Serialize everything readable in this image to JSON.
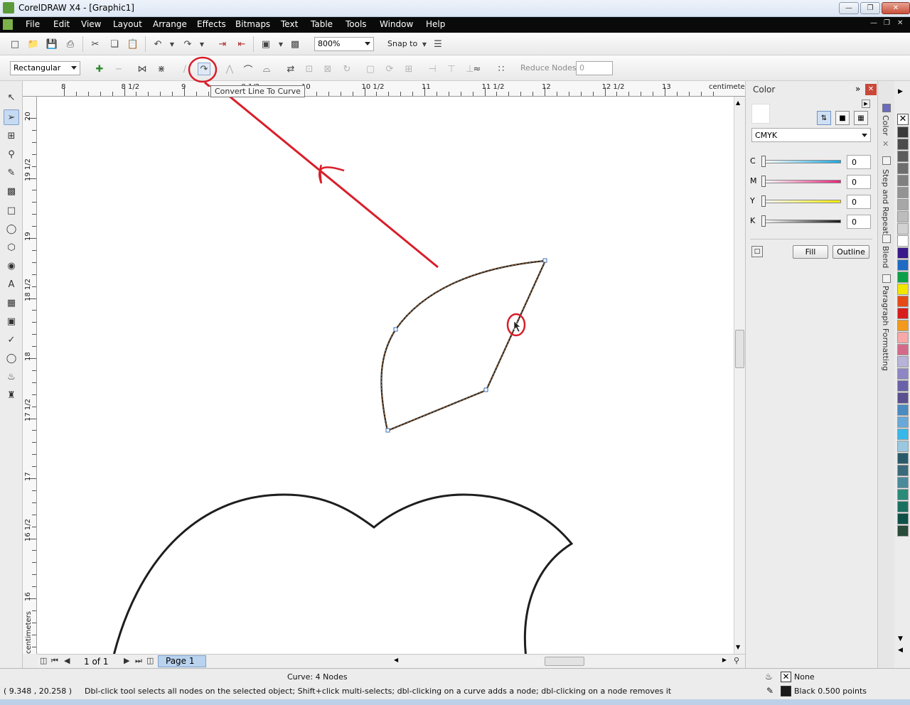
{
  "window": {
    "title": "CorelDRAW X4 - [Graphic1]"
  },
  "menu": [
    "File",
    "Edit",
    "View",
    "Layout",
    "Arrange",
    "Effects",
    "Bitmaps",
    "Text",
    "Table",
    "Tools",
    "Window",
    "Help"
  ],
  "toolbar": {
    "zoom": "800%",
    "snap_label": "Snap to"
  },
  "property_bar": {
    "selection_mode": "Rectangular",
    "reduce_nodes_label": "Reduce Nodes",
    "reduce_nodes_value": "0"
  },
  "tooltip": "Convert Line To Curve",
  "ruler": {
    "h_labels": [
      "8",
      "8 1/2",
      "9",
      "9 1/2",
      "10",
      "10 1/2",
      "11",
      "11 1/2",
      "12",
      "12 1/2",
      "13"
    ],
    "v_labels": [
      "20",
      "19 1/2",
      "19",
      "18 1/2",
      "18",
      "17 1/2",
      "17",
      "16 1/2",
      "16"
    ],
    "unit": "centimeters"
  },
  "page_nav": {
    "count": "1 of 1",
    "page_tab": "Page 1"
  },
  "docker": {
    "title": "Color",
    "model": "CMYK",
    "channels": [
      {
        "name": "C",
        "value": "0"
      },
      {
        "name": "M",
        "value": "0"
      },
      {
        "name": "Y",
        "value": "0"
      },
      {
        "name": "K",
        "value": "0"
      }
    ],
    "fill_button": "Fill",
    "outline_button": "Outline"
  },
  "docker_tabs": [
    "Color",
    "Step and Repeat",
    "Blend",
    "Paragraph Formatting"
  ],
  "palette": [
    "#3a3a3a",
    "#4b4b4b",
    "#5c5c5c",
    "#6e6e6e",
    "#808080",
    "#939393",
    "#a7a7a7",
    "#bcbcbc",
    "#d2d2d2",
    "#ffffff",
    "#3a1a8a",
    "#1e6bc4",
    "#0aa048",
    "#f2e600",
    "#e64a14",
    "#d81c1c",
    "#f39a1c",
    "#f7a8a8",
    "#d46a8a",
    "#b7b2d8",
    "#8e86c4",
    "#6a62a8",
    "#5a5090",
    "#4a8ac0",
    "#6aa8d8",
    "#38b8e8",
    "#9ac8e0",
    "#2a5a6a",
    "#3a6a7a",
    "#4a8a9a",
    "#2a8a7a",
    "#1a7060",
    "#0e5048",
    "#2a4a3a"
  ],
  "status": {
    "object_info": "Curve: 4 Nodes",
    "coords": "( 9.348 , 20.258 )",
    "hint": "Dbl-click tool selects all nodes on the selected object; Shift+click multi-selects; dbl-clicking on a curve adds a node; dbl-clicking on a node removes it",
    "fill_label": "None",
    "outline_label": "Black  0.500 points"
  }
}
